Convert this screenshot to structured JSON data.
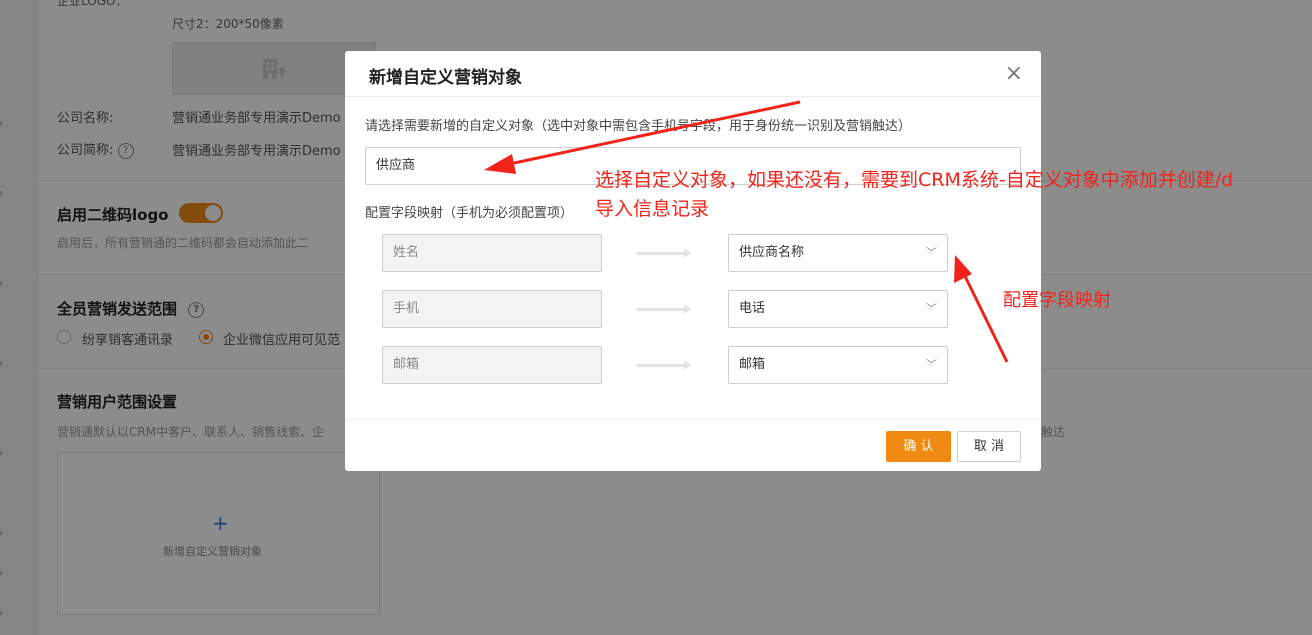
{
  "background": {
    "size_hint": "尺寸2：200*50像素",
    "logo_label": "企业LOGO：",
    "company_name_label": "公司名称:",
    "company_name_value": "营销通业务部专用演示Demo",
    "company_short_label": "公司简称:",
    "company_short_value": "营销通业务部专用演示Demo",
    "qr_logo_title": "启用二维码logo",
    "qr_logo_desc": "启用后，所有营销通的二维码都会自动添加此二",
    "send_scope_title": "全员营销发送范围",
    "radio_1": "纷享销客通讯录",
    "radio_2": "企业微信应用可见范",
    "user_scope_title": "营销用户范围设置",
    "user_scope_desc": "营销通默认以CRM中客户、联系人、销售线索、企",
    "user_scope_desc_tail": "触达",
    "add_plus": "+",
    "add_label": "新增自定义营销对象",
    "help_mark": "?"
  },
  "modal": {
    "title": "新增自定义营销对象",
    "close_glyph": "×",
    "select_prompt": "请选择需要新增的自定义对象（选中对象中需包含手机号字段，用于身份统一识别及营销触达）",
    "selected_object": "供应商",
    "mapping_title": "配置字段映射（手机为必须配置项）",
    "mappings": [
      {
        "source": "姓名",
        "target": "供应商名称"
      },
      {
        "source": "手机",
        "target": "电话"
      },
      {
        "source": "邮箱",
        "target": "邮箱"
      }
    ],
    "confirm_label": "确 认",
    "cancel_label": "取 消"
  },
  "annotations": {
    "note_1_line1": "选择自定义对象，如果还没有，需要到CRM系统-自定义对象中添加并创建/d",
    "note_1_line2": "导入信息记录",
    "note_2": "配置字段映射",
    "color": "#f0241a"
  },
  "colors": {
    "accent": "#f08a12",
    "overlay": "rgba(0,0,0,0.45)"
  }
}
